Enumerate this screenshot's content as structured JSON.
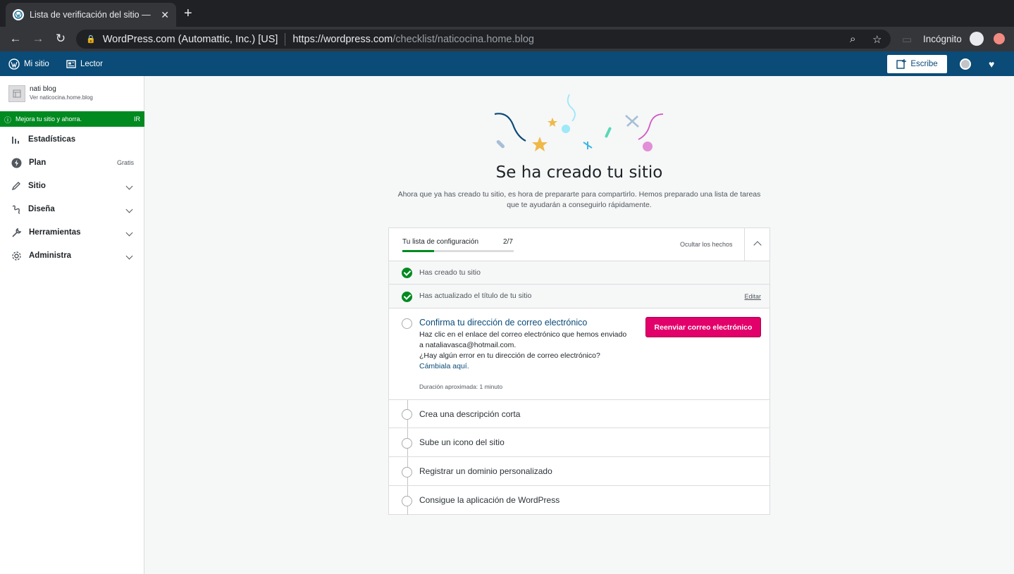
{
  "browser": {
    "tab_title": "Lista de verificación del sitio —",
    "org": "WordPress.com (Automattic, Inc.) [US]",
    "url_host": "https://wordpress.com",
    "url_path": "/checklist/naticocina.home.blog",
    "incognito_label": "Incógnito"
  },
  "masterbar": {
    "my_site": "Mi sitio",
    "reader": "Lector",
    "write": "Escribe"
  },
  "sidebar": {
    "site_name": "nati blog",
    "site_url": "Ver naticocina.home.blog",
    "upsell_text": "Mejora tu sitio y ahorra.",
    "upsell_cta": "IR",
    "items": [
      {
        "label": "Estadísticas",
        "icon": "stats-icon"
      },
      {
        "label": "Plan",
        "icon": "plan-icon",
        "badge": "Gratis"
      },
      {
        "label": "Sitio",
        "icon": "pencil-icon"
      },
      {
        "label": "Diseña",
        "icon": "brush-icon"
      },
      {
        "label": "Herramientas",
        "icon": "wrench-icon"
      },
      {
        "label": "Administra",
        "icon": "gear-icon"
      }
    ]
  },
  "hero": {
    "title": "Se ha creado tu sitio",
    "subtitle": "Ahora que ya has creado tu sitio, es hora de prepararte para compartirlo. Hemos preparado una lista de tareas que te ayudarán a conseguirlo rápidamente."
  },
  "checklist": {
    "label": "Tu lista de configuración",
    "count": "2/7",
    "progress": 0.2857,
    "hide_label": "Ocultar los hechos",
    "tasks": [
      {
        "title": "Has creado tu sitio",
        "done": true
      },
      {
        "title": "Has actualizado el título de tu sitio",
        "done": true,
        "action": "Editar"
      },
      {
        "title": "Confirma tu dirección de correo electrónico",
        "done": false,
        "desc_line1": "Haz clic en el enlace del correo electrónico que hemos enviado a nataliavasca@hotmail.com.",
        "desc_line2": "¿Hay algún error en tu dirección de correo electrónico?",
        "link": "Cámbiala aquí.",
        "duration": "Duración aproximada: 1 minuto",
        "button": "Reenviar correo electrónico"
      },
      {
        "title": "Crea una descripción corta",
        "done": false
      },
      {
        "title": "Sube un icono del sitio",
        "done": false
      },
      {
        "title": "Registrar un dominio personalizado",
        "done": false
      },
      {
        "title": "Consigue la aplicación de WordPress",
        "done": false
      }
    ]
  }
}
